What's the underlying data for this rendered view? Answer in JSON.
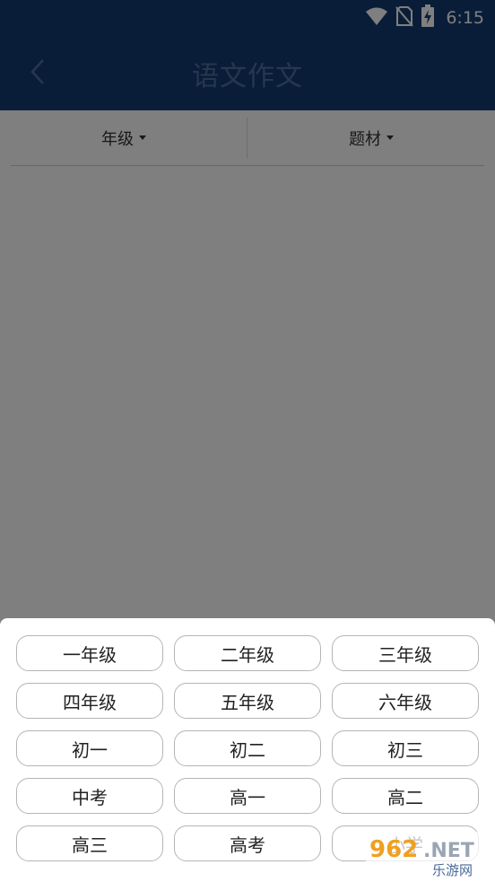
{
  "status_bar": {
    "time": "6:15",
    "icons": [
      "wifi-icon",
      "no-sim-icon",
      "battery-charging-icon"
    ]
  },
  "app_bar": {
    "title": "语文作文",
    "back_icon": "chevron-left-icon"
  },
  "filters": [
    {
      "label": "年级",
      "icon": "caret-down-icon"
    },
    {
      "label": "题材",
      "icon": "caret-down-icon"
    }
  ],
  "grade_options": [
    {
      "label": "一年级"
    },
    {
      "label": "二年级"
    },
    {
      "label": "三年级"
    },
    {
      "label": "四年级"
    },
    {
      "label": "五年级"
    },
    {
      "label": "六年级"
    },
    {
      "label": "初一"
    },
    {
      "label": "初二"
    },
    {
      "label": "初三"
    },
    {
      "label": "中考"
    },
    {
      "label": "高一"
    },
    {
      "label": "高二"
    },
    {
      "label": "高三"
    },
    {
      "label": "高考"
    },
    {
      "label": "小学"
    }
  ],
  "watermark": {
    "logo_text": "962.NET",
    "sub_text": "乐游网"
  },
  "colors": {
    "app_bar": "#123b73",
    "title_text": "#4d6f9c",
    "overlay": "rgba(0,0,0,0.5)",
    "option_border": "#b5b5b5"
  }
}
